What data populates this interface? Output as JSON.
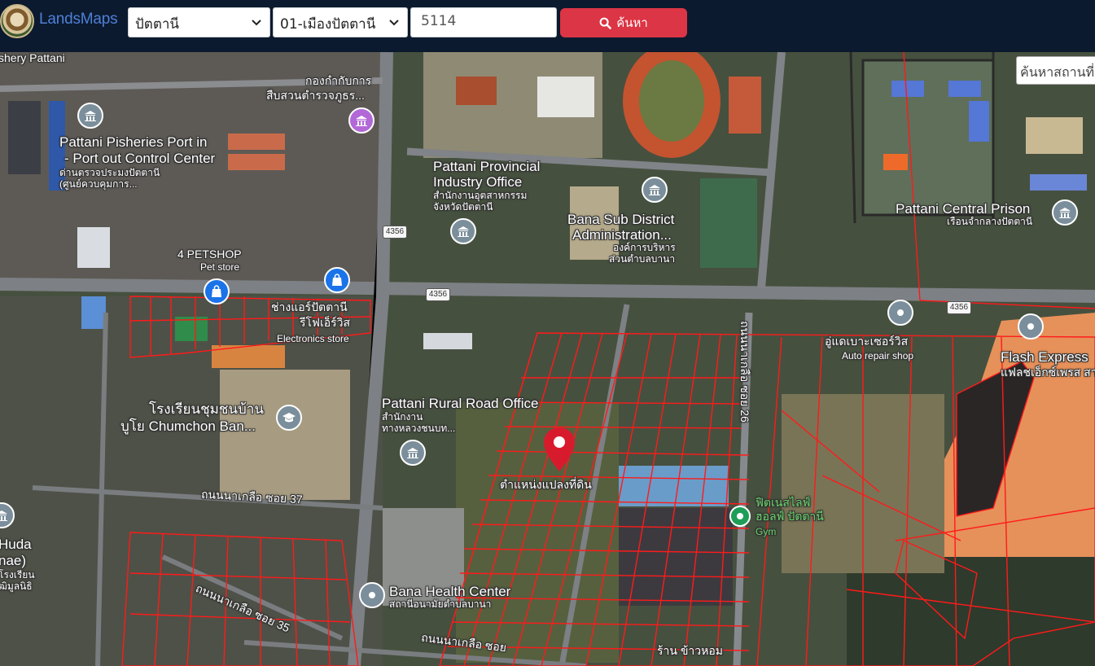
{
  "header": {
    "brand": "LandsMaps",
    "province_selected": "ปัตตานี",
    "district_selected": "01-เมืองปัตตานี",
    "parcel_number": "5114",
    "search_label": "ค้นหา"
  },
  "map": {
    "search_placeholder": "ค้นหาสถานที่",
    "marker_label": "ตำแหน่งแปลงที่ดิน",
    "road_shields": [
      "4356",
      "4356",
      "4356"
    ],
    "places": {
      "fishery": "shery Pattani",
      "police_1": "กองกำกับการ",
      "police_2": "สืบสวนตำรวจภูธร...",
      "port_1": "Pattani Pisheries Port in",
      "port_2": "- Port out Control Center",
      "port_3": "ด่านตรวจประมงปัตตานี",
      "port_4": "(ศูนย์ควบคุมการ...",
      "industry_1": "Pattani Provincial",
      "industry_2": "Industry Office",
      "industry_3": "สำนักงานอุตสาหกรรม",
      "industry_4": "จังหวัดปัตตานี",
      "bana_sao_1": "Bana Sub District",
      "bana_sao_2": "Administration...",
      "bana_sao_3": "องค์การบริหาร",
      "bana_sao_4": "ส่วนตำบลบานา",
      "prison_1": "Pattani Central Prison",
      "prison_2": "เรือนจำกลางปัตตานี",
      "petshop_1": "4 PETSHOP",
      "petshop_2": "Pet store",
      "electronics_1": "ช่างแอร์ปัตตานี",
      "electronics_2": "รีโฟเอ็ร์วิส",
      "electronics_3": "Electronics store",
      "auto_1": "อู่แดเบาะเซอร์วิส",
      "auto_2": "Auto repair shop",
      "flash_1": "Flash Express",
      "flash_2": "แฟลชเอ็กซ์เพรส สาข",
      "school_1": "โรงเรียนชุมชนบ้าน",
      "school_2": "บูโย Chumchon Ban...",
      "rural_1": "Pattani Rural Road Office",
      "rural_2": "สำนักงาน",
      "rural_3": "ทางหลวงชนบท...",
      "soi37": "ถนนนาเกลือ ซอย 37",
      "soi35": "ถนนนาเกลือ ซอย 35",
      "soi_bottom": "ถนนนาเกลือ ซอย",
      "soi26": "ถนนนาเกลือ ซอย 26",
      "gym_1": "ฟิตเนสไลฟ์",
      "gym_2": "ฮอลฟ์ ปัตตานี",
      "gym_3": "Gym",
      "health_1": "Bana Health Center",
      "health_2": "สถานีอนามัยตำบลบานา",
      "shop_bottom": "ร้าน ข้าวหอม",
      "huda_1": "Huda",
      "huda_2": "nae)",
      "huda_3": "โรงเรียน",
      "huda_4": "ุฒิมูลนิธิ"
    }
  },
  "colors": {
    "header_bg": "#0b1a2e",
    "brand": "#4f7fd8",
    "search_button": "#dc3545",
    "parcel_lines": "#ff1a1a",
    "marker": "#d81b2c"
  }
}
